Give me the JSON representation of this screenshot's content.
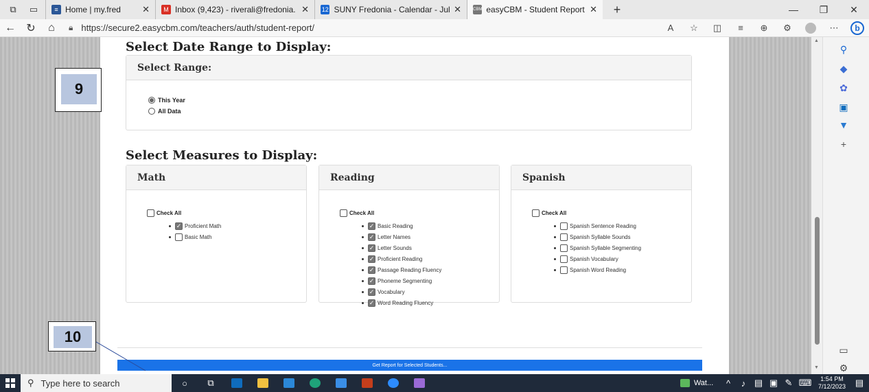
{
  "browser": {
    "tabs": [
      {
        "title": "Home | my.fred",
        "fav_color": "#2b5797",
        "fav_text": "≡"
      },
      {
        "title": "Inbox (9,423) - riverali@fredonia.",
        "fav_color": "#d93025",
        "fav_text": "M"
      },
      {
        "title": "SUNY Fredonia - Calendar - July",
        "fav_color": "#1967d2",
        "fav_text": "12"
      },
      {
        "title": "easyCBM - Student Report : Dist",
        "fav_color": "#777777",
        "fav_text": "CBM"
      }
    ],
    "new_tab_label": "+",
    "url": "https://secure2.easycbm.com/teachers/auth/student-report/"
  },
  "page": {
    "date_section_title": "Select Date Range to Display:",
    "range_panel_title": "Select Range:",
    "range_options": [
      {
        "label": "This Year",
        "checked": true
      },
      {
        "label": "All Data",
        "checked": false
      }
    ],
    "measures_section_title": "Select Measures to Display:",
    "panels": [
      {
        "title": "Math",
        "check_all_label": "Check All",
        "items": [
          {
            "label": "Proficient Math",
            "checked": true
          },
          {
            "label": "Basic Math",
            "checked": false
          }
        ]
      },
      {
        "title": "Reading",
        "check_all_label": "Check All",
        "items": [
          {
            "label": "Basic Reading",
            "checked": true
          },
          {
            "label": "Letter Names",
            "checked": true
          },
          {
            "label": "Letter Sounds",
            "checked": true
          },
          {
            "label": "Proficient Reading",
            "checked": true
          },
          {
            "label": "Passage Reading Fluency",
            "checked": true
          },
          {
            "label": "Phoneme Segmenting",
            "checked": true
          },
          {
            "label": "Vocabulary",
            "checked": true
          },
          {
            "label": "Word Reading Fluency",
            "checked": true
          }
        ]
      },
      {
        "title": "Spanish",
        "check_all_label": "Check All",
        "items": [
          {
            "label": "Spanish Sentence Reading",
            "checked": false
          },
          {
            "label": "Spanish Syllable Sounds",
            "checked": false
          },
          {
            "label": "Spanish Syllable Segmenting",
            "checked": false
          },
          {
            "label": "Spanish Vocabulary",
            "checked": false
          },
          {
            "label": "Spanish Word Reading",
            "checked": false
          }
        ]
      }
    ],
    "get_report_label": "Get Report for Selected Students..."
  },
  "annotations": {
    "step_9": "9",
    "step_10": "10"
  },
  "taskbar": {
    "search_placeholder": "Type here to search",
    "weather_label": "Wat...",
    "time": "1:54 PM",
    "date": "7/12/2023"
  },
  "colors": {
    "accent": "#1a73e8",
    "note_fill": "#b8c6df"
  }
}
